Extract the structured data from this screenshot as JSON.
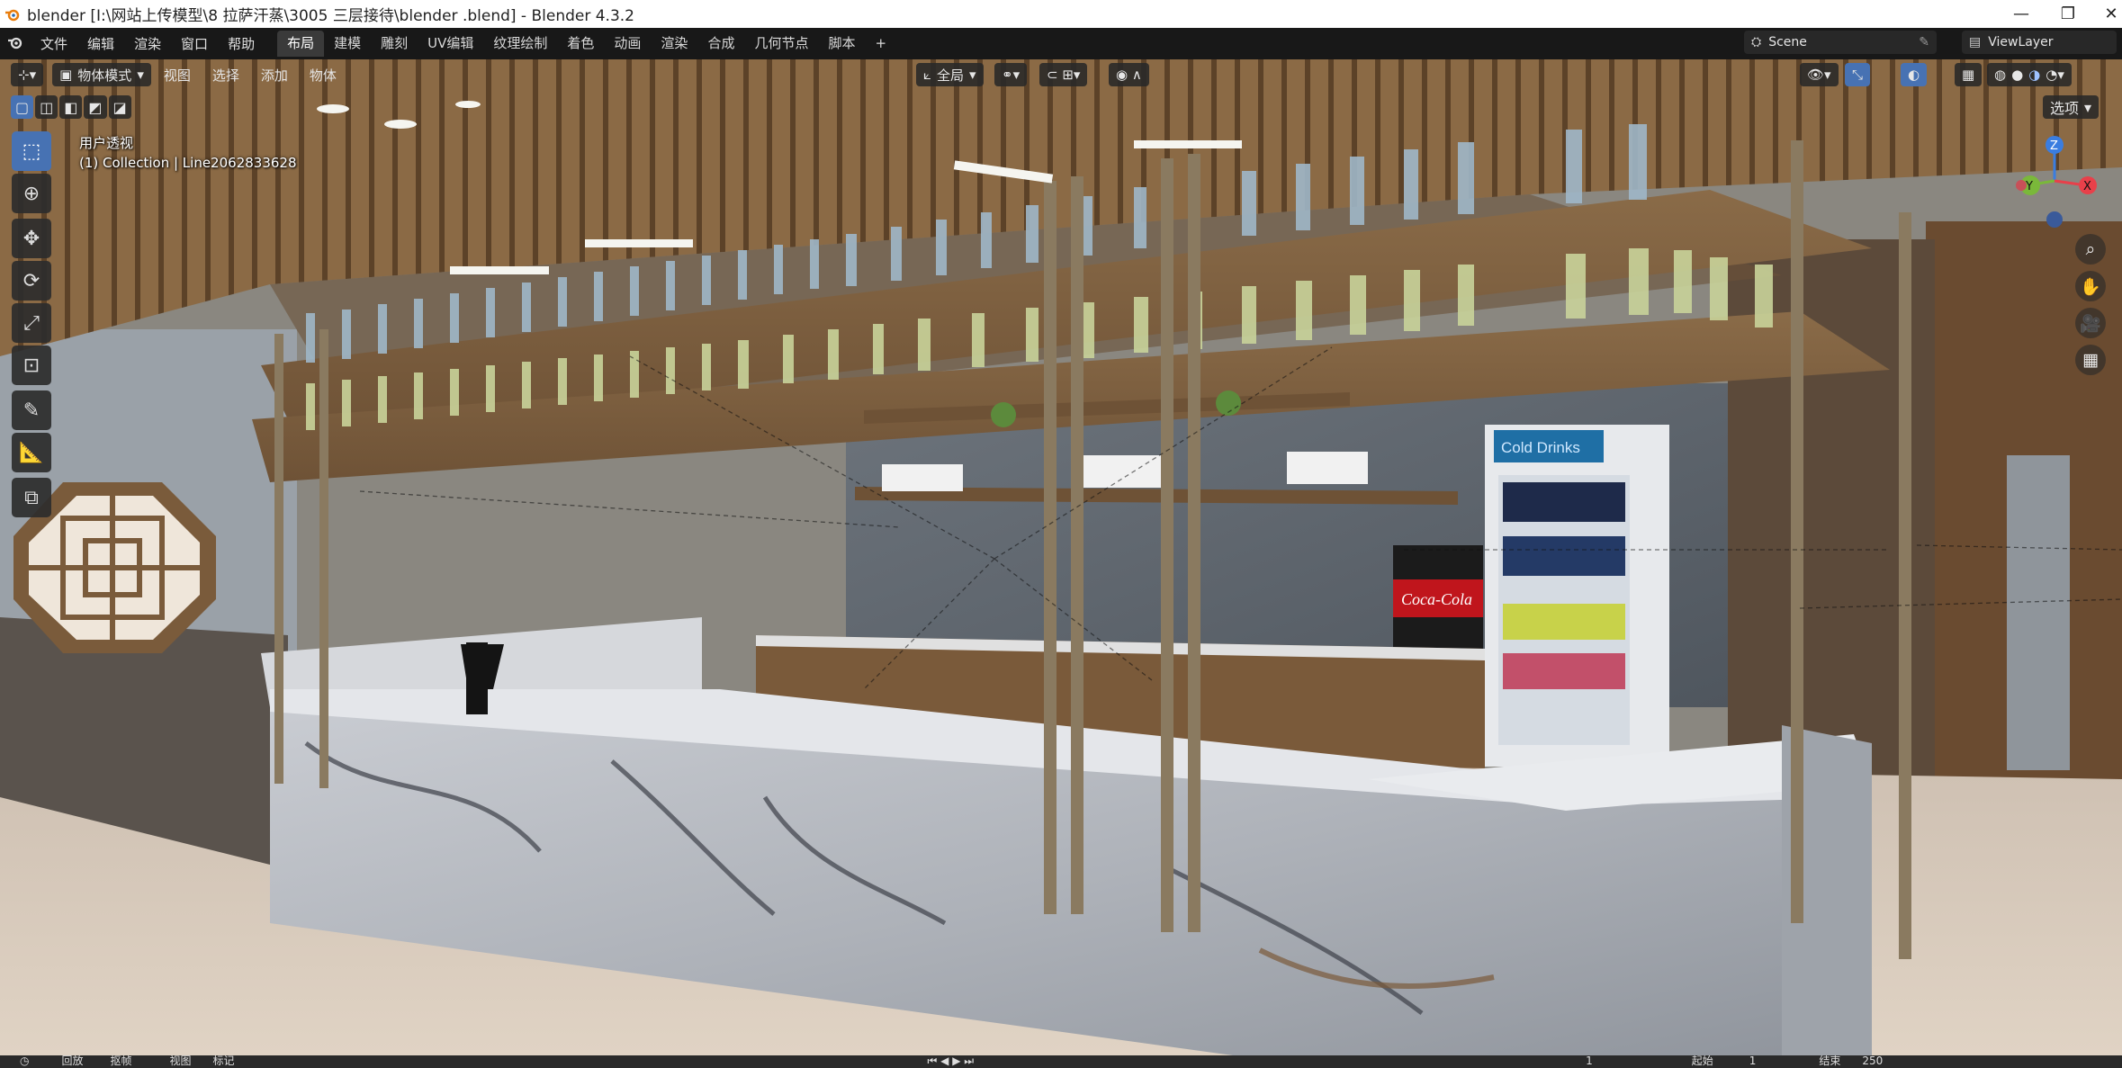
{
  "window": {
    "title": "blender  [I:\\网站上传模型\\8 拉萨汗蒸\\3005 三层接待\\blender .blend] - Blender 4.3.2",
    "minimize_glyph": "—",
    "maximize_glyph": "❐",
    "close_glyph": "✕"
  },
  "menu": {
    "items": [
      "文件",
      "编辑",
      "渲染",
      "窗口",
      "帮助"
    ]
  },
  "workspaces": {
    "tabs": [
      "布局",
      "建模",
      "雕刻",
      "UV编辑",
      "纹理绘制",
      "着色",
      "动画",
      "渲染",
      "合成",
      "几何节点",
      "脚本"
    ],
    "active_index": 0,
    "add_glyph": "+"
  },
  "scene": {
    "name": "Scene",
    "view_layer": "ViewLayer"
  },
  "viewport_header": {
    "mode": "物体模式",
    "menus": [
      "视图",
      "选择",
      "添加",
      "物体"
    ],
    "transform_orientation": "全局",
    "options_label": "选项"
  },
  "viewport_overlay": {
    "view_name": "用户透视",
    "collection_info": "(1) Collection | Line2062833628"
  },
  "gizmo": {
    "z": "Z",
    "y": "Y",
    "x": "X"
  },
  "icons": {
    "toolbar": [
      "select-box-icon",
      "cursor-icon",
      "move-icon",
      "rotate-icon",
      "scale-icon",
      "transform-icon",
      "annotate-icon",
      "measure-icon",
      "add-cube-icon"
    ],
    "navigation": [
      "zoom-icon",
      "pan-hand-icon",
      "camera-view-icon",
      "grid-view-icon"
    ]
  },
  "scene_labels": {
    "cooler_brand": "Cold Drinks",
    "dispenser_brand": "Coca-Cola"
  },
  "timeline": {
    "items": [
      "回放",
      "抠帧",
      "视图",
      "标记"
    ],
    "start_label": "起始",
    "end_label": "结束",
    "current_frame": "1",
    "start_frame": "1",
    "end_frame": "250"
  },
  "colors": {
    "accent_blue": "#4772b3",
    "header_bg": "#181818",
    "button_bg": "#282828",
    "gizmo_x": "#e8404a",
    "gizmo_y": "#7ab83a",
    "gizmo_z": "#3a7de0"
  }
}
